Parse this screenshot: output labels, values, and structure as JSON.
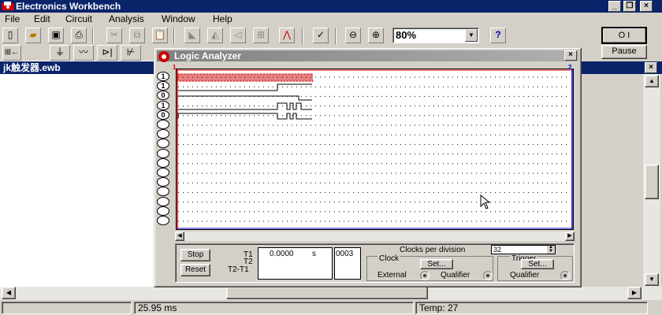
{
  "app": {
    "title": "Electronics Workbench"
  },
  "menu": [
    "File",
    "Edit",
    "Circuit",
    "Analysis",
    "Window",
    "Help"
  ],
  "toolbar": {
    "zoom": "80%",
    "help_label": "?",
    "pause_label": "Pause",
    "power_label": "O I"
  },
  "document": {
    "title": "jk触发器.ewb"
  },
  "status": {
    "time": "25.95 ms",
    "temp": "Temp:  27"
  },
  "logic_analyzer": {
    "title": "Logic Analyzer",
    "terminals": [
      "1",
      "1",
      "0",
      "1",
      "0",
      "",
      "",
      "",
      "",
      "",
      "",
      "",
      "",
      "",
      "",
      ""
    ],
    "marker1": "1",
    "marker2": "2",
    "stop_label": "Stop",
    "reset_label": "Reset",
    "t1_label": "T1",
    "t2_label": "T2",
    "t2t1_label": "T2-T1",
    "t1_value": "0.0000",
    "t1_unit": "s",
    "hex_value": "0003",
    "clocks_label": "Clocks per division",
    "clocks_value": "32",
    "clock_label": "Clock",
    "trigger_label": "Trigger",
    "set_label": "Set...",
    "external_label": "External",
    "qualifier_label": "Qualifier",
    "accent": "#0000cc"
  }
}
